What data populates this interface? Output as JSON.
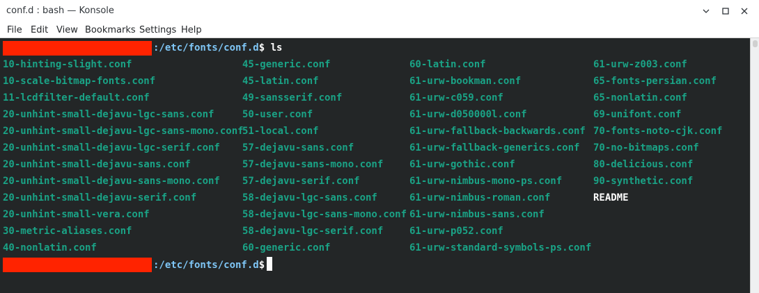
{
  "window": {
    "title": "conf.d : bash — Konsole"
  },
  "menu": {
    "items": [
      "File",
      "Edit",
      "View",
      "Bookmarks",
      "Settings",
      "Help"
    ]
  },
  "terminal": {
    "prompt_path": ":/etc/fonts/conf.d",
    "prompt_symbol": "$",
    "command": " ls",
    "columns": [
      [
        "10-hinting-slight.conf",
        "10-scale-bitmap-fonts.conf",
        "11-lcdfilter-default.conf",
        "20-unhint-small-dejavu-lgc-sans.conf",
        "20-unhint-small-dejavu-lgc-sans-mono.conf",
        "20-unhint-small-dejavu-lgc-serif.conf",
        "20-unhint-small-dejavu-sans.conf",
        "20-unhint-small-dejavu-sans-mono.conf",
        "20-unhint-small-dejavu-serif.conf",
        "20-unhint-small-vera.conf",
        "30-metric-aliases.conf",
        "40-nonlatin.conf"
      ],
      [
        "45-generic.conf",
        "45-latin.conf",
        "49-sansserif.conf",
        "50-user.conf",
        "51-local.conf",
        "57-dejavu-sans.conf",
        "57-dejavu-sans-mono.conf",
        "57-dejavu-serif.conf",
        "58-dejavu-lgc-sans.conf",
        "58-dejavu-lgc-sans-mono.conf",
        "58-dejavu-lgc-serif.conf",
        "60-generic.conf"
      ],
      [
        "60-latin.conf",
        "61-urw-bookman.conf",
        "61-urw-c059.conf",
        "61-urw-d050000l.conf",
        "61-urw-fallback-backwards.conf",
        "61-urw-fallback-generics.conf",
        "61-urw-gothic.conf",
        "61-urw-nimbus-mono-ps.conf",
        "61-urw-nimbus-roman.conf",
        "61-urw-nimbus-sans.conf",
        "61-urw-p052.conf",
        "61-urw-standard-symbols-ps.conf"
      ],
      [
        "61-urw-z003.conf",
        "65-fonts-persian.conf",
        "65-nonlatin.conf",
        "69-unifont.conf",
        "70-fonts-noto-cjk.conf",
        "70-no-bitmaps.conf",
        "80-delicious.conf",
        "90-synthetic.conf",
        "README"
      ]
    ],
    "plain_entries": [
      "README"
    ]
  },
  "colors": {
    "background": "#232627",
    "symlink_file": "#1aa386",
    "path": "#7fc6f6",
    "text": "#fcfcfc",
    "redaction": "#ff2300"
  }
}
